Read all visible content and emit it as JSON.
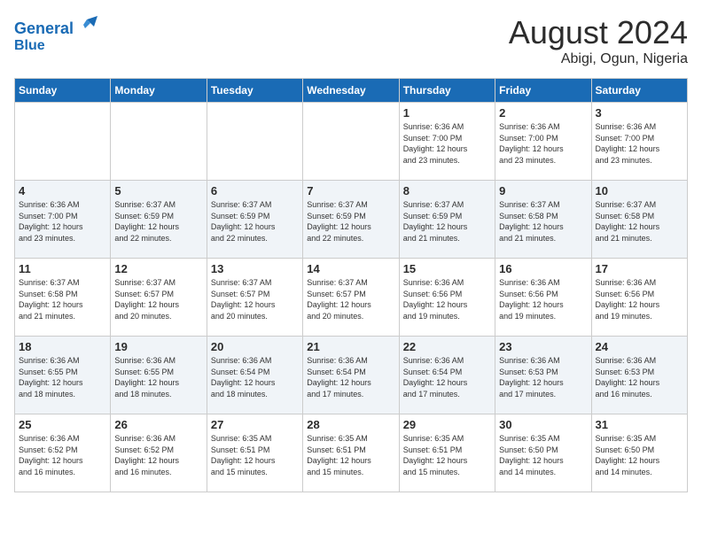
{
  "logo": {
    "line1": "General",
    "line2": "Blue"
  },
  "title": "August 2024",
  "location": "Abigi, Ogun, Nigeria",
  "weekdays": [
    "Sunday",
    "Monday",
    "Tuesday",
    "Wednesday",
    "Thursday",
    "Friday",
    "Saturday"
  ],
  "weeks": [
    [
      {
        "day": "",
        "info": ""
      },
      {
        "day": "",
        "info": ""
      },
      {
        "day": "",
        "info": ""
      },
      {
        "day": "",
        "info": ""
      },
      {
        "day": "1",
        "info": "Sunrise: 6:36 AM\nSunset: 7:00 PM\nDaylight: 12 hours\nand 23 minutes."
      },
      {
        "day": "2",
        "info": "Sunrise: 6:36 AM\nSunset: 7:00 PM\nDaylight: 12 hours\nand 23 minutes."
      },
      {
        "day": "3",
        "info": "Sunrise: 6:36 AM\nSunset: 7:00 PM\nDaylight: 12 hours\nand 23 minutes."
      }
    ],
    [
      {
        "day": "4",
        "info": "Sunrise: 6:36 AM\nSunset: 7:00 PM\nDaylight: 12 hours\nand 23 minutes."
      },
      {
        "day": "5",
        "info": "Sunrise: 6:37 AM\nSunset: 6:59 PM\nDaylight: 12 hours\nand 22 minutes."
      },
      {
        "day": "6",
        "info": "Sunrise: 6:37 AM\nSunset: 6:59 PM\nDaylight: 12 hours\nand 22 minutes."
      },
      {
        "day": "7",
        "info": "Sunrise: 6:37 AM\nSunset: 6:59 PM\nDaylight: 12 hours\nand 22 minutes."
      },
      {
        "day": "8",
        "info": "Sunrise: 6:37 AM\nSunset: 6:59 PM\nDaylight: 12 hours\nand 21 minutes."
      },
      {
        "day": "9",
        "info": "Sunrise: 6:37 AM\nSunset: 6:58 PM\nDaylight: 12 hours\nand 21 minutes."
      },
      {
        "day": "10",
        "info": "Sunrise: 6:37 AM\nSunset: 6:58 PM\nDaylight: 12 hours\nand 21 minutes."
      }
    ],
    [
      {
        "day": "11",
        "info": "Sunrise: 6:37 AM\nSunset: 6:58 PM\nDaylight: 12 hours\nand 21 minutes."
      },
      {
        "day": "12",
        "info": "Sunrise: 6:37 AM\nSunset: 6:57 PM\nDaylight: 12 hours\nand 20 minutes."
      },
      {
        "day": "13",
        "info": "Sunrise: 6:37 AM\nSunset: 6:57 PM\nDaylight: 12 hours\nand 20 minutes."
      },
      {
        "day": "14",
        "info": "Sunrise: 6:37 AM\nSunset: 6:57 PM\nDaylight: 12 hours\nand 20 minutes."
      },
      {
        "day": "15",
        "info": "Sunrise: 6:36 AM\nSunset: 6:56 PM\nDaylight: 12 hours\nand 19 minutes."
      },
      {
        "day": "16",
        "info": "Sunrise: 6:36 AM\nSunset: 6:56 PM\nDaylight: 12 hours\nand 19 minutes."
      },
      {
        "day": "17",
        "info": "Sunrise: 6:36 AM\nSunset: 6:56 PM\nDaylight: 12 hours\nand 19 minutes."
      }
    ],
    [
      {
        "day": "18",
        "info": "Sunrise: 6:36 AM\nSunset: 6:55 PM\nDaylight: 12 hours\nand 18 minutes."
      },
      {
        "day": "19",
        "info": "Sunrise: 6:36 AM\nSunset: 6:55 PM\nDaylight: 12 hours\nand 18 minutes."
      },
      {
        "day": "20",
        "info": "Sunrise: 6:36 AM\nSunset: 6:54 PM\nDaylight: 12 hours\nand 18 minutes."
      },
      {
        "day": "21",
        "info": "Sunrise: 6:36 AM\nSunset: 6:54 PM\nDaylight: 12 hours\nand 17 minutes."
      },
      {
        "day": "22",
        "info": "Sunrise: 6:36 AM\nSunset: 6:54 PM\nDaylight: 12 hours\nand 17 minutes."
      },
      {
        "day": "23",
        "info": "Sunrise: 6:36 AM\nSunset: 6:53 PM\nDaylight: 12 hours\nand 17 minutes."
      },
      {
        "day": "24",
        "info": "Sunrise: 6:36 AM\nSunset: 6:53 PM\nDaylight: 12 hours\nand 16 minutes."
      }
    ],
    [
      {
        "day": "25",
        "info": "Sunrise: 6:36 AM\nSunset: 6:52 PM\nDaylight: 12 hours\nand 16 minutes."
      },
      {
        "day": "26",
        "info": "Sunrise: 6:36 AM\nSunset: 6:52 PM\nDaylight: 12 hours\nand 16 minutes."
      },
      {
        "day": "27",
        "info": "Sunrise: 6:35 AM\nSunset: 6:51 PM\nDaylight: 12 hours\nand 15 minutes."
      },
      {
        "day": "28",
        "info": "Sunrise: 6:35 AM\nSunset: 6:51 PM\nDaylight: 12 hours\nand 15 minutes."
      },
      {
        "day": "29",
        "info": "Sunrise: 6:35 AM\nSunset: 6:51 PM\nDaylight: 12 hours\nand 15 minutes."
      },
      {
        "day": "30",
        "info": "Sunrise: 6:35 AM\nSunset: 6:50 PM\nDaylight: 12 hours\nand 14 minutes."
      },
      {
        "day": "31",
        "info": "Sunrise: 6:35 AM\nSunset: 6:50 PM\nDaylight: 12 hours\nand 14 minutes."
      }
    ]
  ]
}
